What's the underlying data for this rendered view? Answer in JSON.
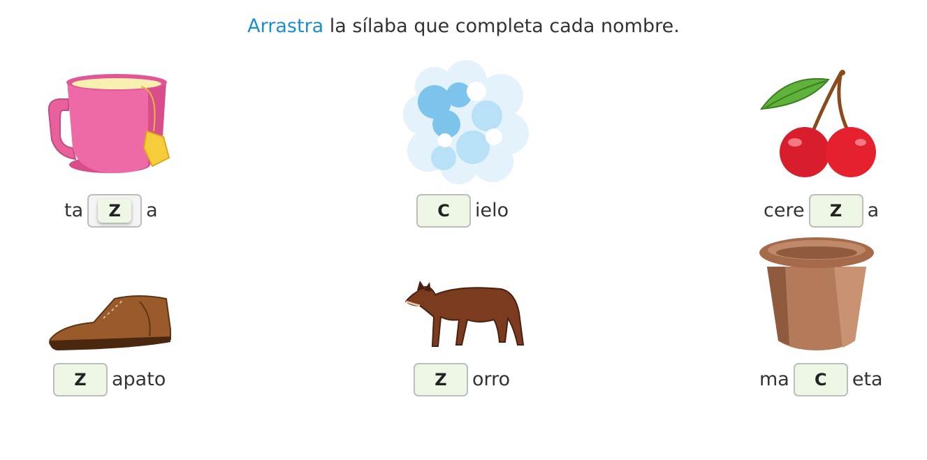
{
  "instruction": {
    "highlight": "Arrastra",
    "rest": " la sílaba que completa cada nombre."
  },
  "colors": {
    "accent": "#1a8fd0",
    "slot_bg": "#eef6e6",
    "slot_border": "#bdbdbd"
  },
  "items": [
    {
      "icon": "cup-icon",
      "prefix": "ta",
      "answer": "Z",
      "suffix": "a"
    },
    {
      "icon": "sky-icon",
      "prefix": "",
      "answer": "C",
      "suffix": "ielo"
    },
    {
      "icon": "cherry-icon",
      "prefix": "cere",
      "answer": "Z",
      "suffix": "a"
    },
    {
      "icon": "shoe-icon",
      "prefix": "",
      "answer": "Z",
      "suffix": "apato"
    },
    {
      "icon": "fox-icon",
      "prefix": "",
      "answer": "Z",
      "suffix": "orro"
    },
    {
      "icon": "flowerpot-icon",
      "prefix": "ma",
      "answer": "C",
      "suffix": "eta"
    }
  ]
}
